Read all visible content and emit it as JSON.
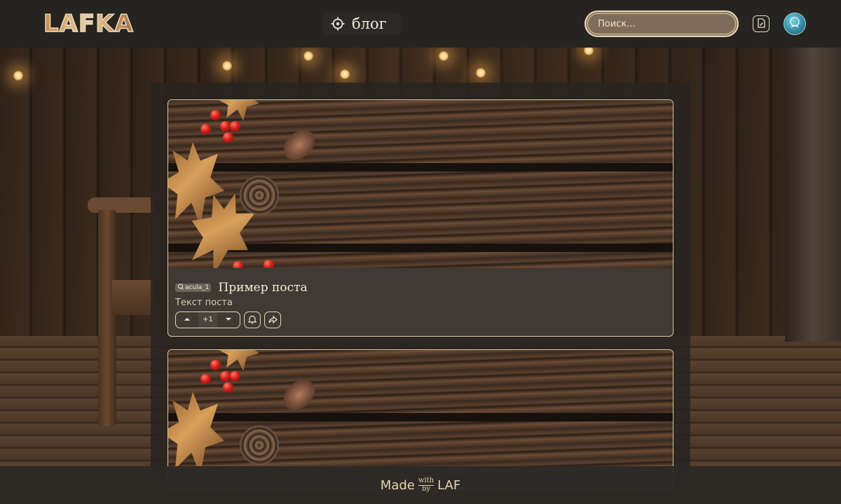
{
  "header": {
    "logo": "LAFKA",
    "nav_label": "блог",
    "nav_icon": "target-icon",
    "search_placeholder": "Поиск...",
    "doc_icon": "document-icon",
    "avatar_icon": "avatar-icon"
  },
  "posts": [
    {
      "author": "acula_1",
      "title": "Пример поста",
      "text": "Текст поста",
      "votes": "+1"
    },
    {
      "author": "",
      "title": "",
      "text": "",
      "votes": ""
    }
  ],
  "footer": {
    "made": "Made",
    "with": "with",
    "by": "by",
    "brand": "LAF"
  },
  "colors": {
    "accent": "#e9d8b8",
    "header_bg": "#262420",
    "card_bg": "#3f3a33"
  }
}
